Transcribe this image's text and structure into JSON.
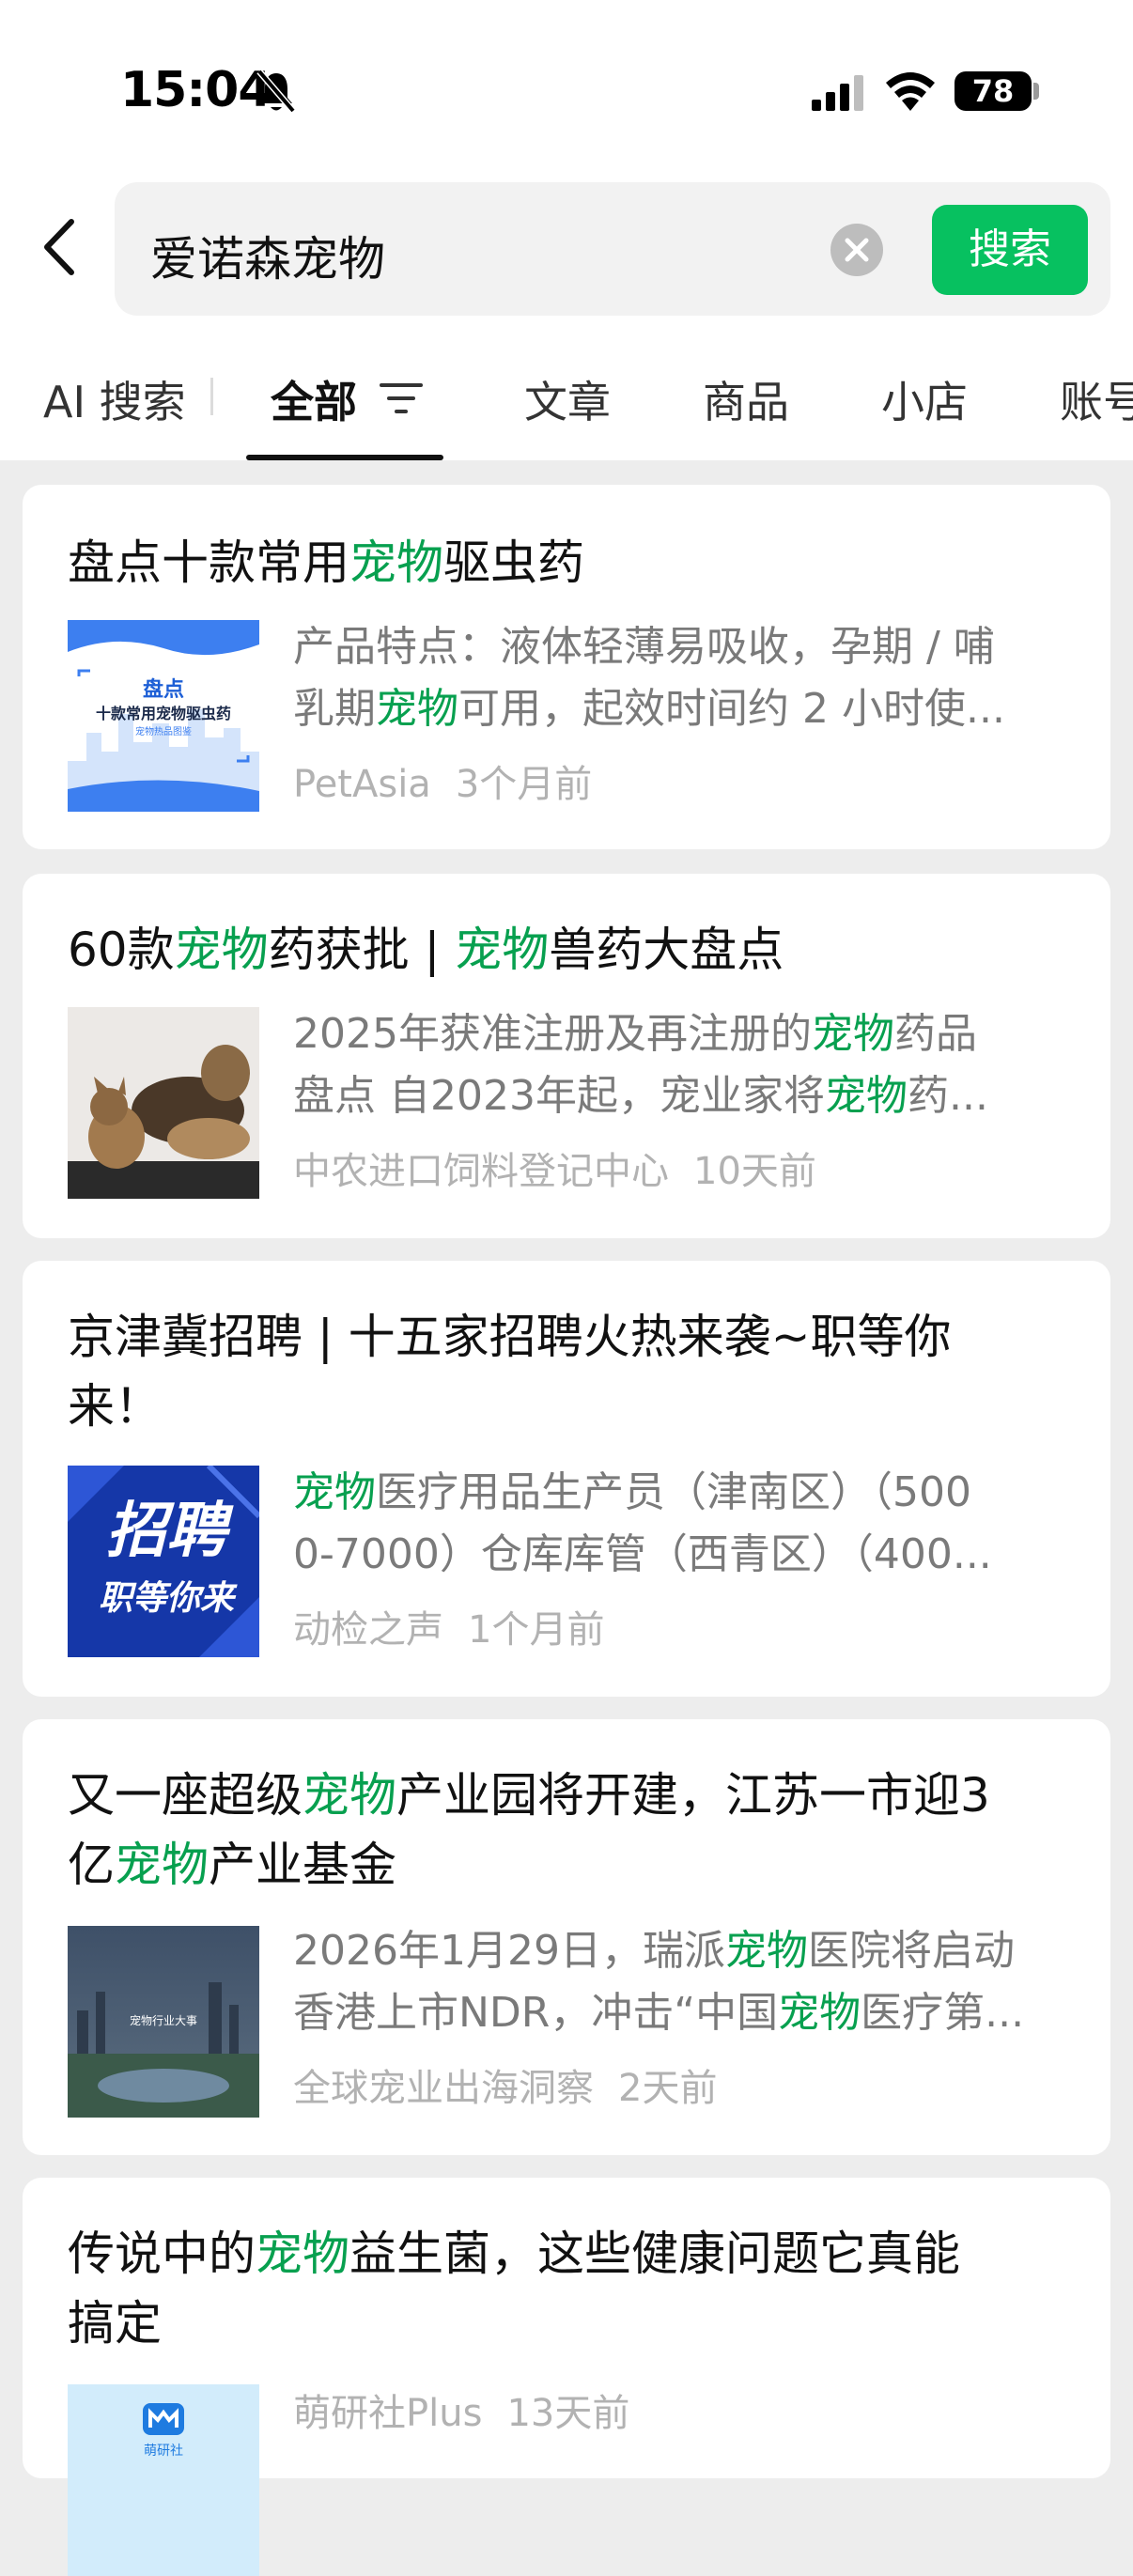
{
  "status": {
    "time": "15:04",
    "battery": "78"
  },
  "search": {
    "query": "爱诺森宠物",
    "button": "搜索"
  },
  "tabs": {
    "ai": "AI 搜索",
    "all": "全部",
    "article": "文章",
    "goods": "商品",
    "shop": "小店",
    "account": "账号"
  },
  "cards": [
    {
      "title": [
        "盘点十款常用",
        "宠物",
        "驱虫药"
      ],
      "thumb_text": [
        "盘点",
        "十款常用宠物驱虫药",
        "宠物热品图鉴"
      ],
      "desc": [
        [
          "产品特点：液体轻薄易吸收，孕期 / 哺"
        ],
        [
          "乳期",
          "宠物",
          "可用，起效时间约 2 小时使..."
        ]
      ],
      "source": "PetAsia",
      "time": "3个月前"
    },
    {
      "title": [
        "60款",
        "宠物",
        "药获批 | ",
        "宠物",
        "兽药大盘点"
      ],
      "desc": [
        [
          "2025年获准注册及再注册的",
          "宠物",
          "药品"
        ],
        [
          "盘点 自2023年起，宠业家将",
          "宠物",
          "药..."
        ]
      ],
      "source": "中农进口饲料登记中心",
      "time": "10天前"
    },
    {
      "title_lines": [
        "京津冀招聘 | 十五家招聘火热来袭~职等你",
        "来！"
      ],
      "thumb_text": [
        "招聘",
        "职等你来"
      ],
      "desc": [
        [
          "",
          "宠物",
          "医疗用品生产员（津南区）（500"
        ],
        [
          "0-7000）仓库库管（西青区）（400..."
        ]
      ],
      "source": "动检之声",
      "time": "1个月前"
    },
    {
      "title_lines": [
        [
          "又一座超级",
          "宠物",
          "产业园将开建，江苏一市迎3"
        ],
        [
          "亿",
          "宠物",
          "产业基金"
        ]
      ],
      "thumb_text": [
        "宠物行业大事"
      ],
      "desc": [
        [
          "2026年1月29日，瑞派",
          "宠物",
          "医院将启动"
        ],
        [
          "香港上市NDR，冲击“中国",
          "宠物",
          "医疗第..."
        ]
      ],
      "source": "全球宠业出海洞察",
      "time": "2天前"
    },
    {
      "title_lines": [
        [
          "传说中的",
          "宠物",
          "益生菌，这些健康问题它真能"
        ],
        [
          "搞定"
        ]
      ],
      "thumb_text": [
        "萌研社"
      ],
      "source": "萌研社Plus",
      "time": "13天前"
    }
  ],
  "colors": {
    "accent": "#07c160",
    "highlight": "#07a04f",
    "meta": "#b2b2b2",
    "desc": "#7a7a7a",
    "page_bg": "#ededed"
  }
}
